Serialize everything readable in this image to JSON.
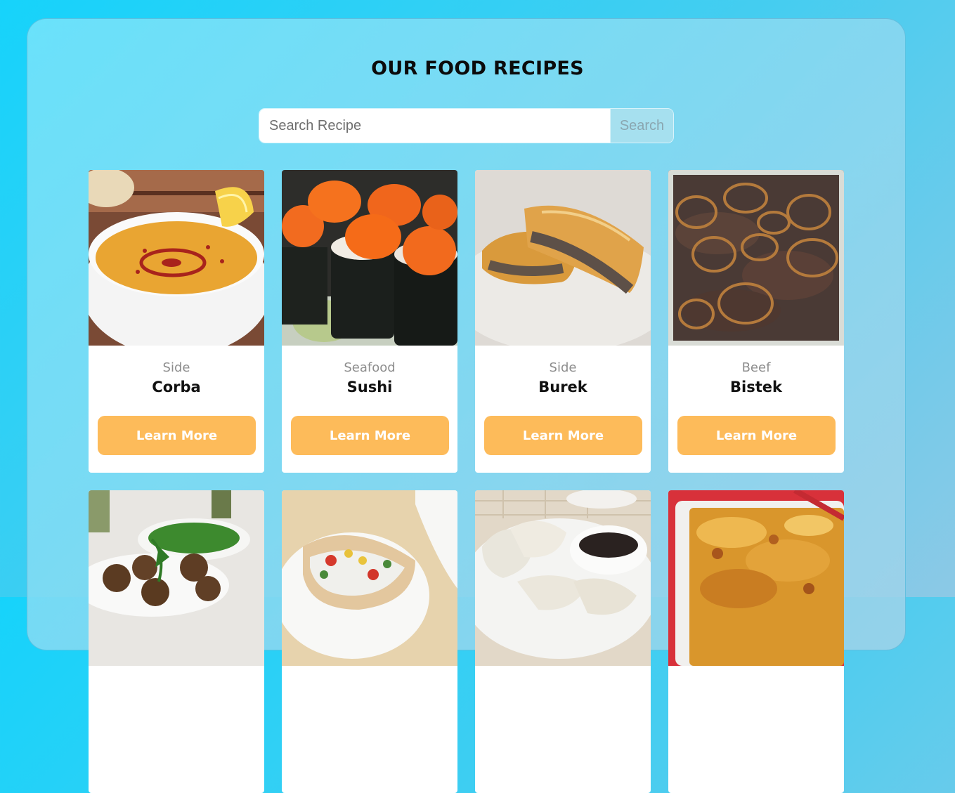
{
  "page": {
    "title": "OUR FOOD RECIPES"
  },
  "search": {
    "placeholder": "Search Recipe",
    "button_label": "Search"
  },
  "recipes": [
    {
      "category": "Side",
      "name": "Corba",
      "button": "Learn More"
    },
    {
      "category": "Seafood",
      "name": "Sushi",
      "button": "Learn More"
    },
    {
      "category": "Side",
      "name": "Burek",
      "button": "Learn More"
    },
    {
      "category": "Beef",
      "name": "Bistek",
      "button": "Learn More"
    },
    {
      "category": "",
      "name": "",
      "button": ""
    },
    {
      "category": "",
      "name": "",
      "button": ""
    },
    {
      "category": "",
      "name": "",
      "button": ""
    },
    {
      "category": "",
      "name": "",
      "button": ""
    }
  ],
  "colors": {
    "accent": "#fdbb5a",
    "background": "#16d3fb"
  }
}
